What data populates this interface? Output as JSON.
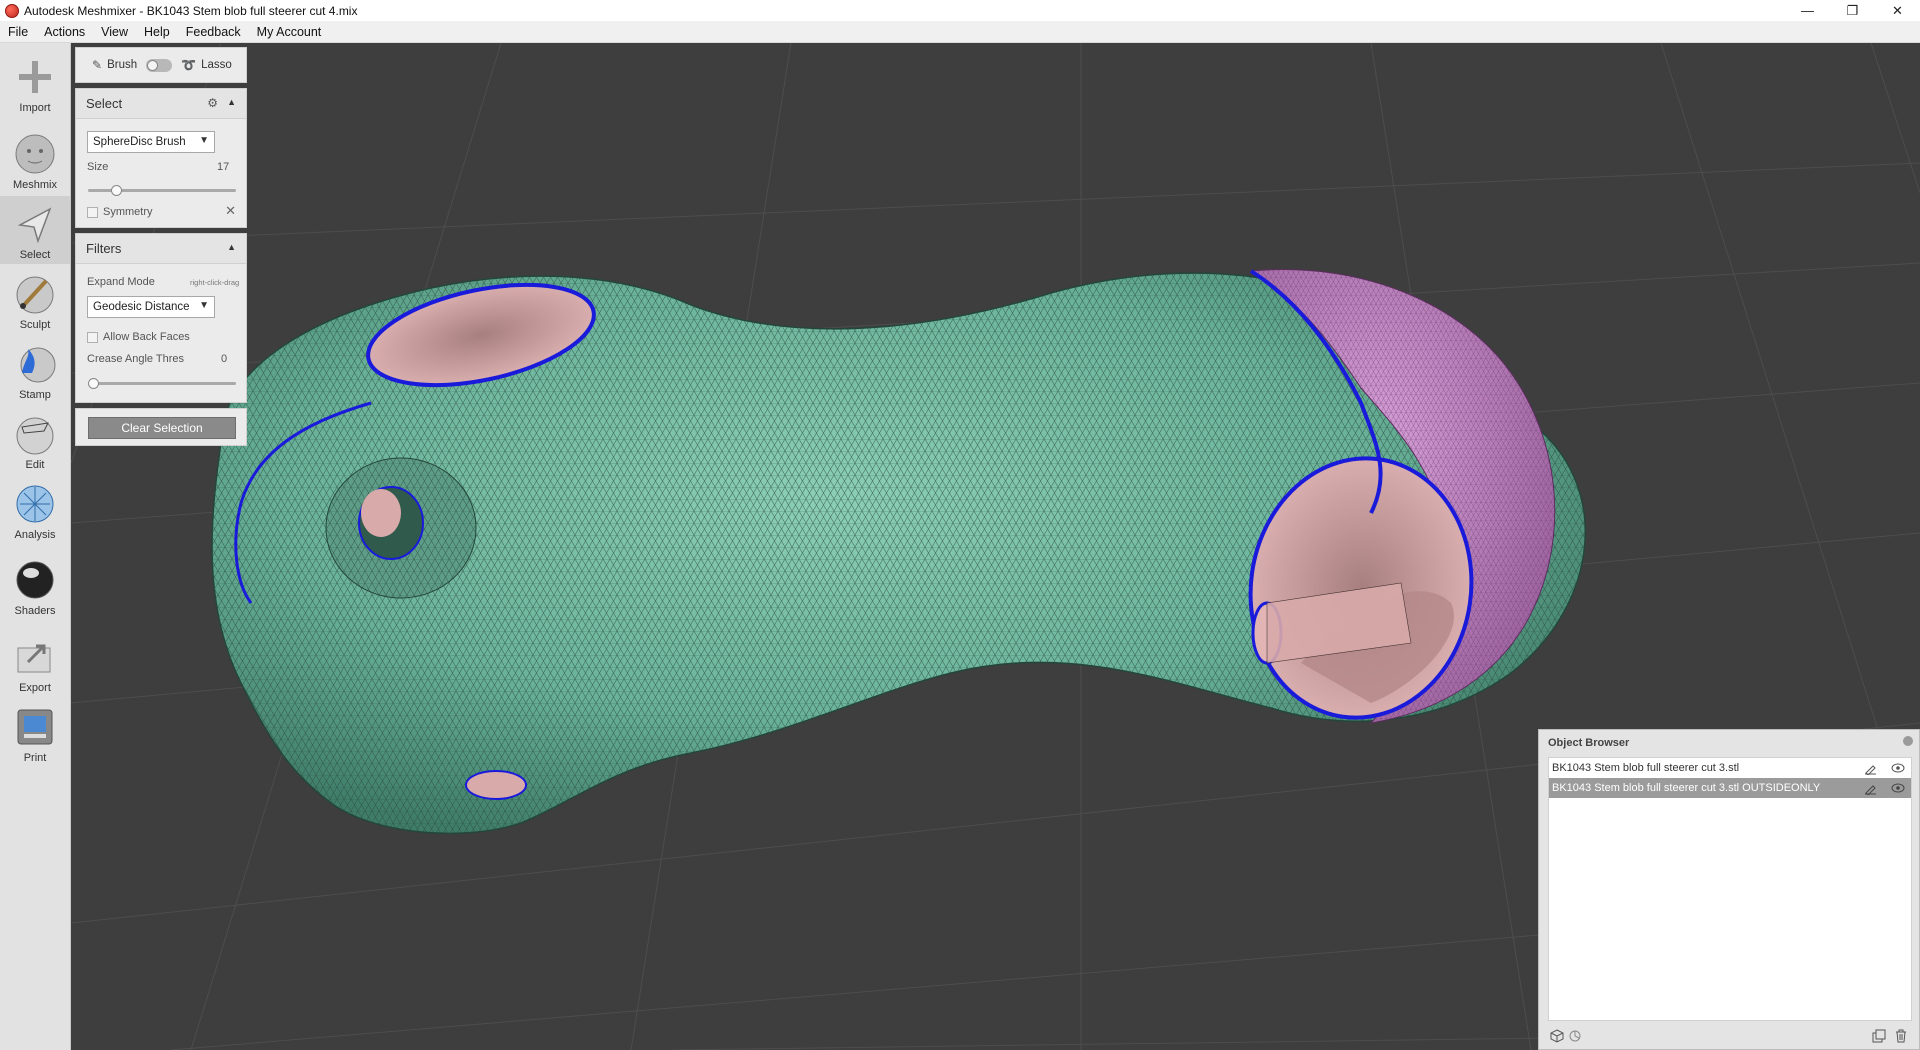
{
  "window": {
    "title": "Autodesk Meshmixer - BK1043 Stem blob full steerer cut 4.mix",
    "controls": [
      "—",
      "❐",
      "✕"
    ]
  },
  "menu": {
    "items": [
      "File",
      "Actions",
      "View",
      "Help",
      "Feedback",
      "My Account"
    ]
  },
  "toolbar": {
    "tools": [
      {
        "label": "Import",
        "icon": "plus-icon"
      },
      {
        "label": "Meshmix",
        "icon": "head-icon"
      },
      {
        "label": "Select",
        "icon": "arrow-pointer-icon",
        "active": true
      },
      {
        "label": "Sculpt",
        "icon": "brush-sphere-icon"
      },
      {
        "label": "Stamp",
        "icon": "stamp-sphere-icon"
      },
      {
        "label": "Edit",
        "icon": "edit-sphere-icon"
      },
      {
        "label": "Analysis",
        "icon": "analysis-sphere-icon"
      },
      {
        "label": "Shaders",
        "icon": "shader-sphere-icon"
      },
      {
        "label": "Export",
        "icon": "export-icon"
      },
      {
        "label": "Print",
        "icon": "printer-icon"
      }
    ]
  },
  "mode_panel": {
    "brush_label": "Brush",
    "lasso_label": "Lasso"
  },
  "select_panel": {
    "title": "Select",
    "brush_type": "SphereDisc Brush",
    "size_label": "Size",
    "size_value": "17",
    "size_fraction": 0.17,
    "symmetry_label": "Symmetry"
  },
  "filters_panel": {
    "title": "Filters",
    "expand_mode_label": "Expand Mode",
    "expand_hint": "right-click-drag",
    "expand_mode_value": "Geodesic Distance",
    "back_faces_label": "Allow Back Faces",
    "crease_label": "Crease Angle Thres",
    "crease_value": "0",
    "crease_fraction": 0.0
  },
  "actions": {
    "clear_selection": "Clear Selection"
  },
  "object_browser": {
    "title": "Object Browser",
    "objects": [
      {
        "name": "BK1043 Stem blob full steerer cut 3.stl",
        "selected": false
      },
      {
        "name": "BK1043 Stem blob full steerer cut 3.stl OUTSIDEONLY",
        "selected": true
      }
    ]
  },
  "colors": {
    "viewport_bg": "#3e3e3e",
    "mesh_green": "#6fb79e",
    "mesh_pink": "#c58fc7",
    "selection_blue": "#1a1adb",
    "hole_interior": "#d4a6a6"
  }
}
